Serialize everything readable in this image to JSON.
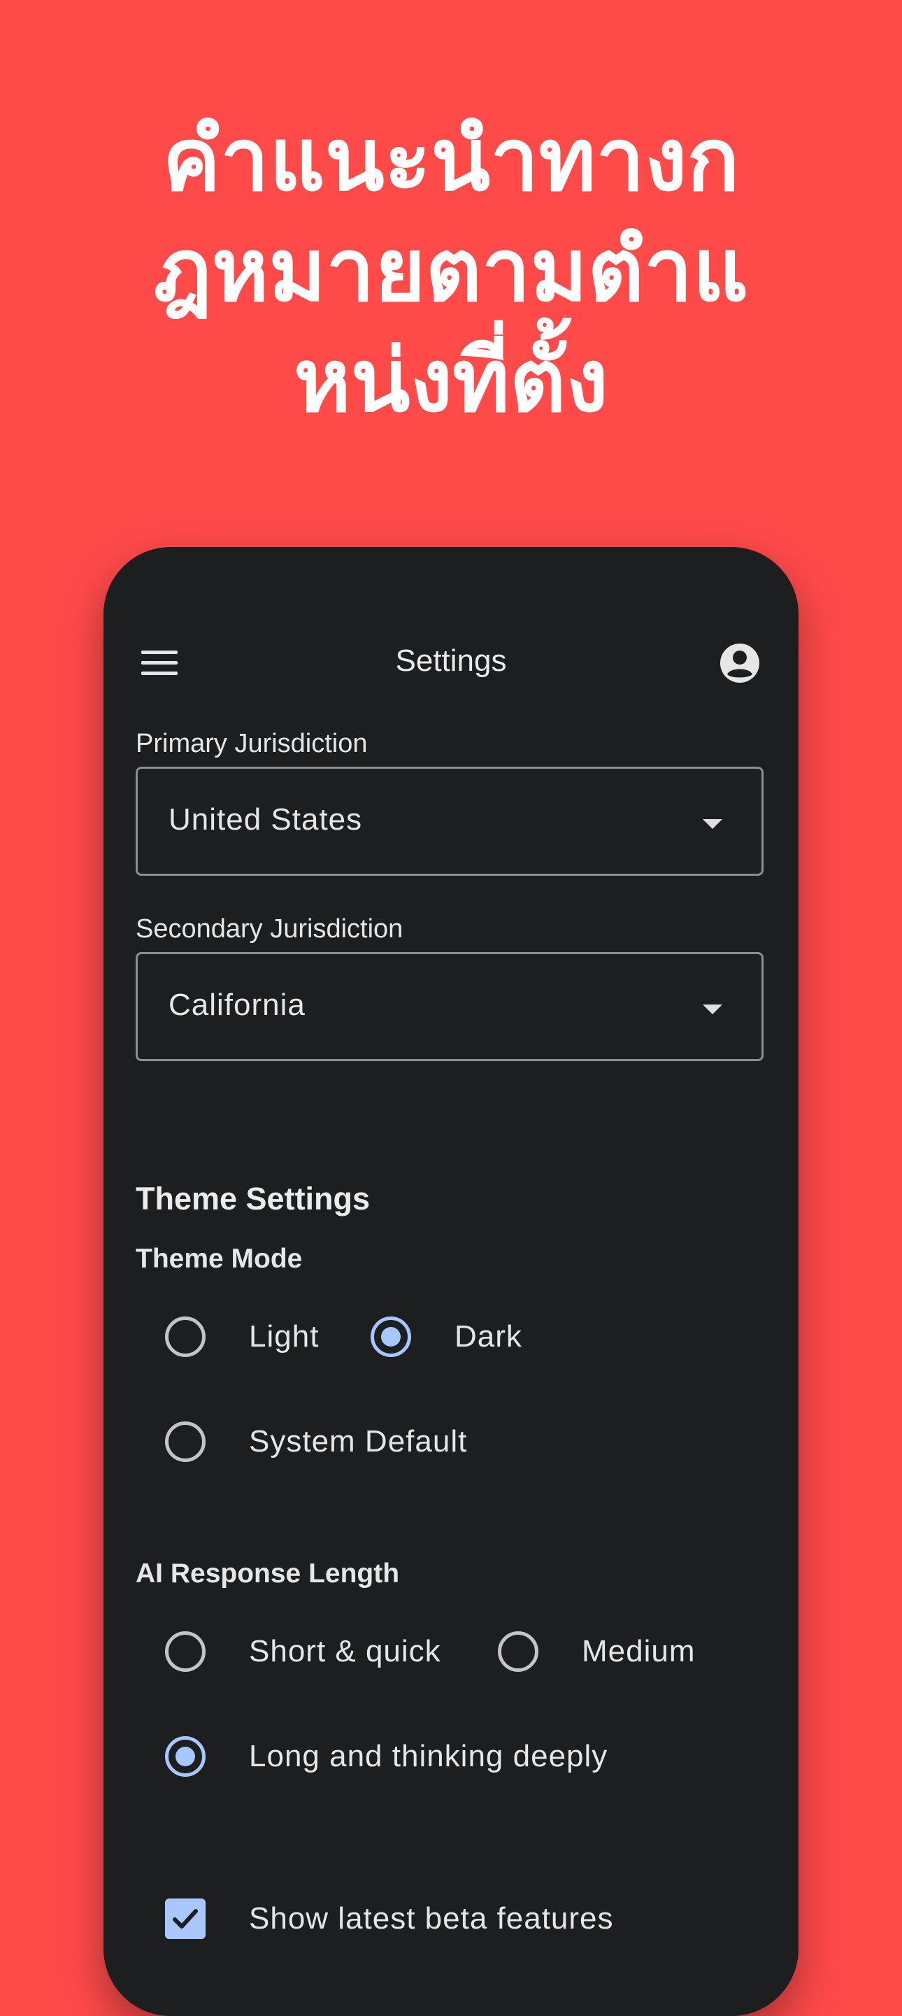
{
  "headline": {
    "line1": "คำแนะนำทางก",
    "line2": "ฎหมายตามตำแ",
    "line3": "หน่งที่ตั้ง"
  },
  "appbar": {
    "title": "Settings",
    "menu_icon": "menu-icon",
    "account_icon": "account-circle-icon"
  },
  "primary_jurisdiction": {
    "label": "Primary Jurisdiction",
    "value": "United States"
  },
  "secondary_jurisdiction": {
    "label": "Secondary Jurisdiction",
    "value": "California"
  },
  "theme_settings": {
    "title": "Theme Settings",
    "mode_label": "Theme Mode",
    "options": [
      "Light",
      "Dark",
      "System Default"
    ],
    "selected": "Dark"
  },
  "ai_response_length": {
    "label": "AI Response Length",
    "options": [
      "Short & quick",
      "Medium",
      "Long and thinking deeply"
    ],
    "selected": "Long and thinking deeply"
  },
  "beta": {
    "label": "Show latest beta features",
    "checked": true
  },
  "colors": {
    "background": "#ff4a4a",
    "phone_surface": "#1d1e20",
    "accent": "#a9c7ff"
  }
}
